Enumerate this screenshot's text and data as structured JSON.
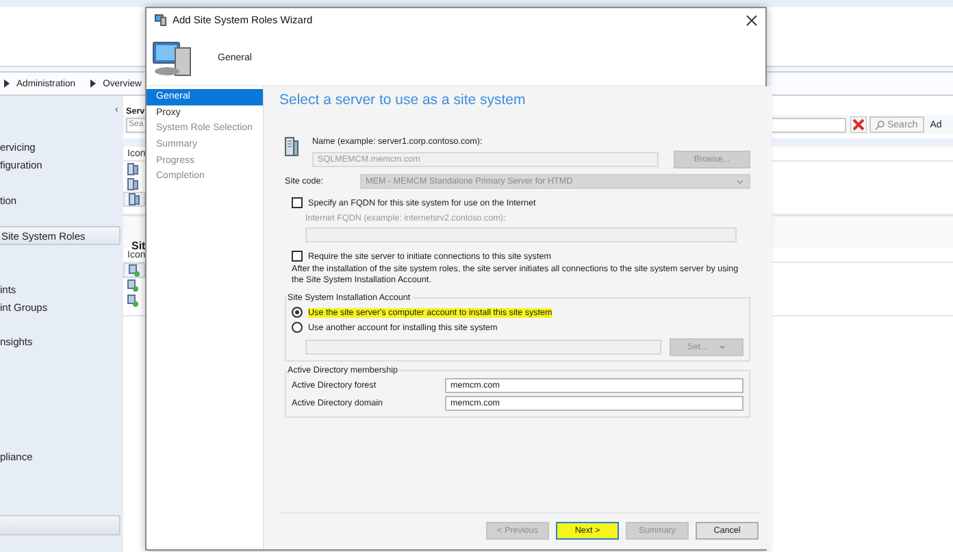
{
  "console": {
    "breadcrumb": [
      "Administration",
      "Overview"
    ],
    "nav": {
      "collapse": "‹",
      "groups": [
        [
          {
            "label": "ervicing",
            "selected": false
          },
          {
            "label": "figuration",
            "selected": false
          }
        ],
        [
          {
            "label": "tion",
            "selected": false
          }
        ],
        [
          {
            "label": "Site System Roles",
            "selected": true
          }
        ],
        [
          {
            "label": "ints",
            "selected": false
          },
          {
            "label": "int Groups",
            "selected": false
          }
        ],
        [
          {
            "label": "nsights",
            "selected": false
          }
        ],
        [
          {
            "label": "pliance",
            "selected": false
          }
        ]
      ]
    },
    "servers_pane": {
      "title": "Serv",
      "search_placeholder": "Sea",
      "search_button": "Search",
      "add_criteria": "Ad",
      "column_1": "Icon",
      "rows": [
        {
          "kind": "server",
          "selected": false
        },
        {
          "kind": "server",
          "selected": false
        },
        {
          "kind": "server",
          "selected": true
        }
      ]
    },
    "roles_pane": {
      "title": "Sit",
      "column_1": "Icon",
      "rows": [
        {
          "kind": "role",
          "selected": true
        },
        {
          "kind": "role",
          "selected": false
        },
        {
          "kind": "role",
          "selected": false
        }
      ]
    }
  },
  "wizard": {
    "title": "Add Site System Roles Wizard",
    "header": "General",
    "steps": [
      {
        "label": "General",
        "selected": true,
        "enabled": true
      },
      {
        "label": "Proxy",
        "selected": false,
        "enabled": true
      },
      {
        "label": "System Role Selection",
        "selected": false,
        "enabled": false
      },
      {
        "label": "Summary",
        "selected": false,
        "enabled": false
      },
      {
        "label": "Progress",
        "selected": false,
        "enabled": false
      },
      {
        "label": "Completion",
        "selected": false,
        "enabled": false
      }
    ],
    "heading": "Select a server to use as a site system",
    "name_label": "Name (example: server1.corp.contoso.com):",
    "name_field": {
      "value": "SQLMEMCM.memcm.com",
      "disabled": true
    },
    "browse_button": {
      "label": "Browse...",
      "disabled": true
    },
    "site_code_label": "Site code:",
    "site_code": {
      "value": "MEM - MEMCM Standalone Primary Server for HTMD",
      "disabled": true
    },
    "fqdn_checkbox": {
      "label": "Specify an FQDN for this site system for use on the Internet",
      "checked": false
    },
    "fqdn_label": "Internet FQDN (example: internetsrv2.contoso.com):",
    "fqdn_field": {
      "disabled": true
    },
    "require_checkbox": {
      "label": "Require the site server to initiate connections to this site system",
      "checked": false
    },
    "note": "After the  installation of the site system roles, the site server initiates all connections to the site system server by using the Site System Installation Account.",
    "install_account": {
      "legend": "Site System Installation Account",
      "options": [
        {
          "label": "Use the site server's computer account to install this site system",
          "selected": true,
          "highlighted": true
        },
        {
          "label": "Use another account for installing this site system",
          "selected": false,
          "highlighted": false
        }
      ],
      "account_field": {
        "disabled": true
      },
      "set_button": {
        "label": "Set...",
        "disabled": true
      }
    },
    "ad_membership": {
      "legend": "Active Directory membership",
      "fields": [
        {
          "label": "Active Directory forest",
          "value": "memcm.com"
        },
        {
          "label": "Active Directory domain",
          "value": "memcm.com"
        }
      ]
    },
    "buttons": [
      {
        "label": "< Previous",
        "disabled": true,
        "highlighted": false
      },
      {
        "label": "Next >",
        "disabled": false,
        "highlighted": true
      },
      {
        "label": "Summary",
        "disabled": true,
        "highlighted": false
      },
      {
        "label": "Cancel",
        "disabled": false,
        "highlighted": false
      }
    ]
  }
}
